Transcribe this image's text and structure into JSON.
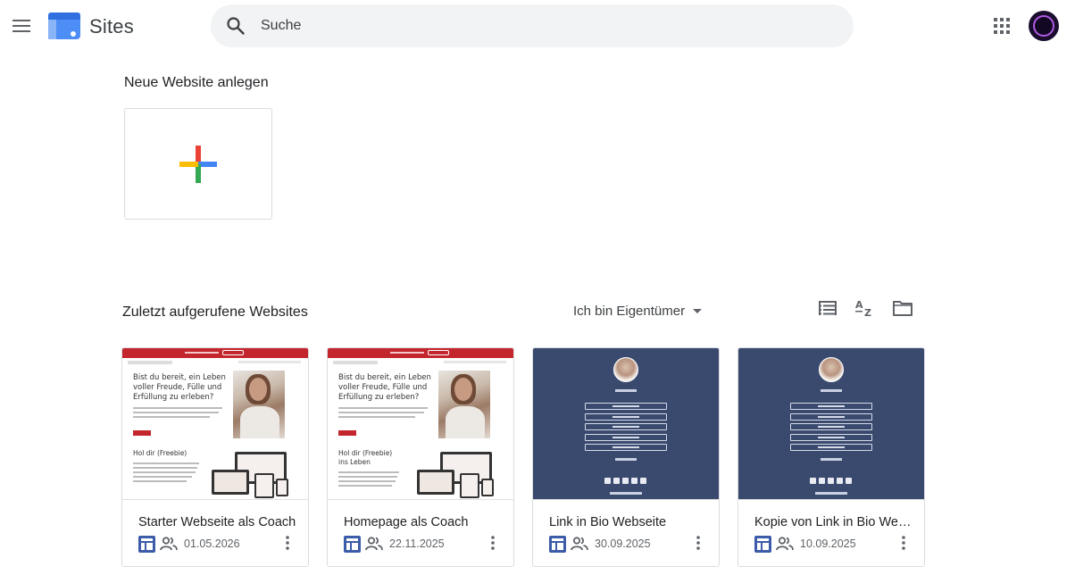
{
  "header": {
    "app_name": "Sites",
    "search_placeholder": "Suche"
  },
  "create": {
    "title": "Neue Website anlegen"
  },
  "recent": {
    "title": "Zuletzt aufgerufene Websites",
    "owner_filter": "Ich bin Eigentümer"
  },
  "thumb_text": {
    "coach_headline": "Bist du bereit, ein Leben voller Freude, Fülle und Erfüllung zu erleben?",
    "coach_subhead_1": "Hol dir (Freebie)",
    "coach_subhead_2": "Hol dir (Freebie) ins Leben"
  },
  "cards": [
    {
      "title": "Starter Webseite als Coach",
      "date": "01.05.2026"
    },
    {
      "title": "Homepage als Coach",
      "date": "22.11.2025"
    },
    {
      "title": "Link in Bio Webseite",
      "date": "30.09.2025"
    },
    {
      "title": "Kopie von Link in Bio Webseite",
      "date": "10.09.2025"
    }
  ],
  "icons": {
    "menu": "hamburger-menu-icon",
    "search": "search-icon",
    "apps": "apps-grid-icon",
    "list_view": "list-view-icon",
    "sort": "sort-az-icon",
    "folder": "folder-icon",
    "site": "site-layout-icon",
    "shared": "people-icon",
    "more": "more-vert-icon"
  },
  "colors": {
    "accent_blue": "#4285f4",
    "accent_red": "#ea4335",
    "accent_yellow": "#fbbc04",
    "accent_green": "#34a853",
    "coach_red": "#c3262c",
    "bio_navy": "#3a4a6e",
    "site_icon_blue": "#3c5ba8"
  }
}
